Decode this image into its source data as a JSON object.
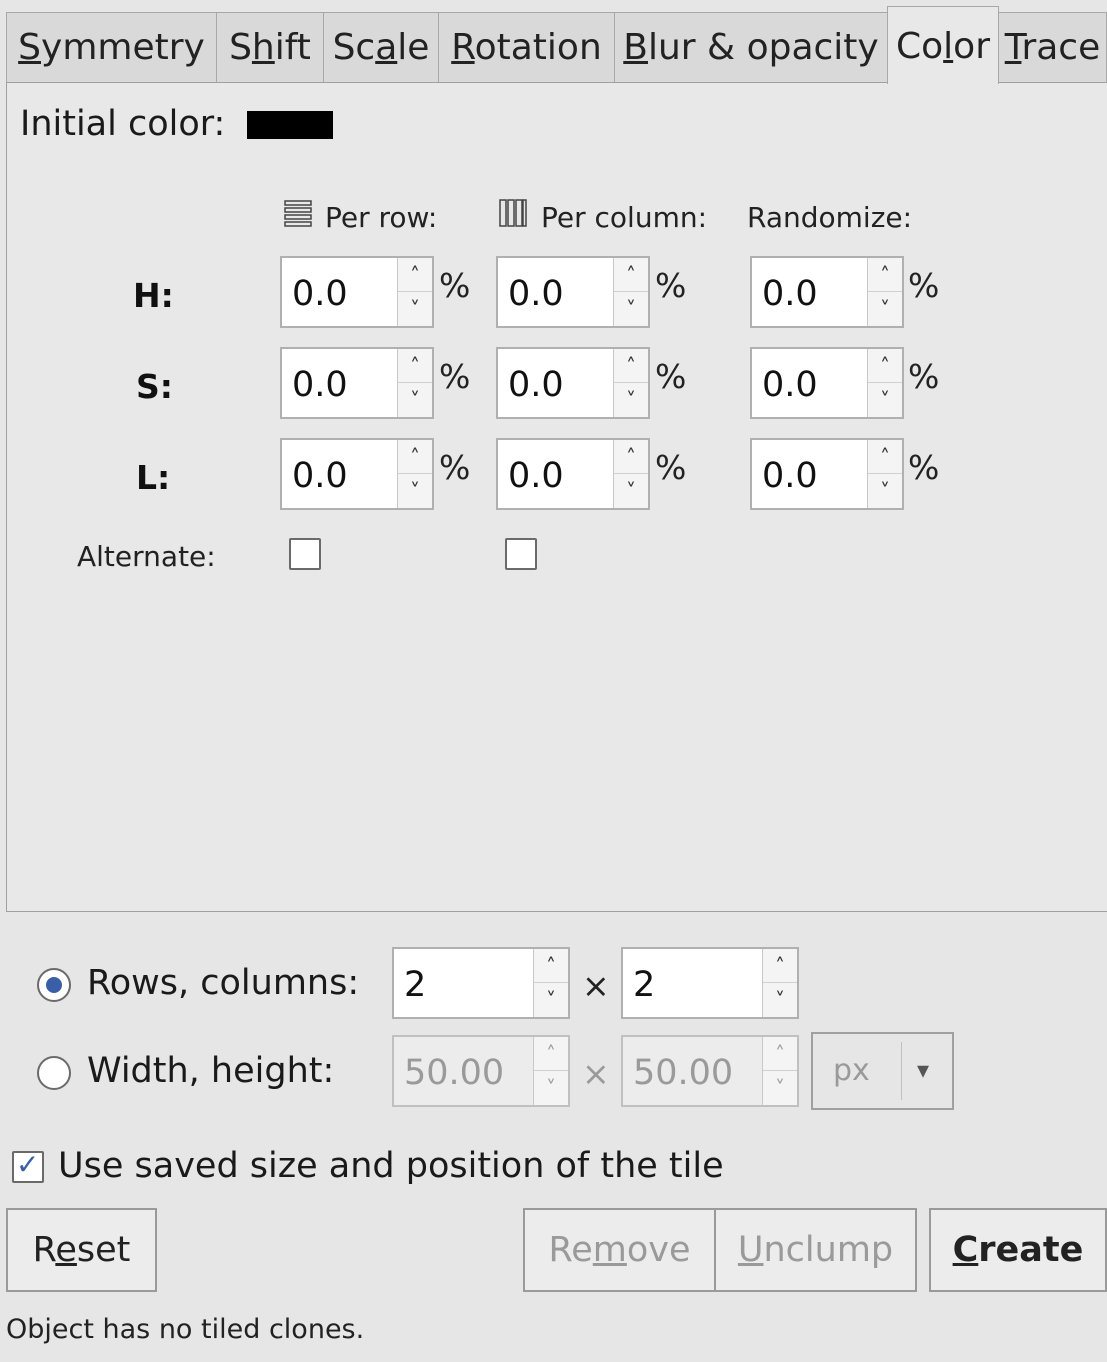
{
  "tabs": [
    {
      "pre": "",
      "key": "S",
      "post": "ymmetry"
    },
    {
      "pre": "S",
      "key": "h",
      "post": "ift"
    },
    {
      "pre": "Sc",
      "key": "a",
      "post": "le"
    },
    {
      "pre": "",
      "key": "R",
      "post": "otation"
    },
    {
      "pre": "",
      "key": "B",
      "post": "lur & opacity"
    },
    {
      "pre": "Co",
      "key": "l",
      "post": "or"
    },
    {
      "pre": "",
      "key": "T",
      "post": "race"
    }
  ],
  "active_tab": "Color",
  "color_panel": {
    "initial_color_label": "Initial color:",
    "initial_color_value": "#000000",
    "col_per_row": "Per row:",
    "col_per_column": "Per column:",
    "col_randomize": "Randomize:",
    "row_h": "H:",
    "row_s": "S:",
    "row_l": "L:",
    "unit": "%",
    "values": {
      "h": [
        "0.0",
        "0.0",
        "0.0"
      ],
      "s": [
        "0.0",
        "0.0",
        "0.0"
      ],
      "l": [
        "0.0",
        "0.0",
        "0.0"
      ]
    },
    "alternate_label": "Alternate:",
    "alternate_row_checked": false,
    "alternate_col_checked": false
  },
  "tiling": {
    "rows_columns_label": "Rows, columns:",
    "rows_value": "2",
    "columns_value": "2",
    "rows_columns_selected": true,
    "width_height_label": "Width, height:",
    "width_value": "50.00",
    "height_value": "50.00",
    "unit_select": "px",
    "times": "×",
    "use_saved_label": "Use saved size and position of the tile",
    "use_saved_checked": true
  },
  "buttons": {
    "reset": {
      "pre": "R",
      "key": "e",
      "post": "set"
    },
    "remove": {
      "pre": "Re",
      "key": "m",
      "post": "ove"
    },
    "unclump": {
      "pre": "",
      "key": "U",
      "post": "nclump"
    },
    "create": {
      "pre": "",
      "key": "C",
      "post": "reate"
    }
  },
  "status": "Object has no tiled clones."
}
